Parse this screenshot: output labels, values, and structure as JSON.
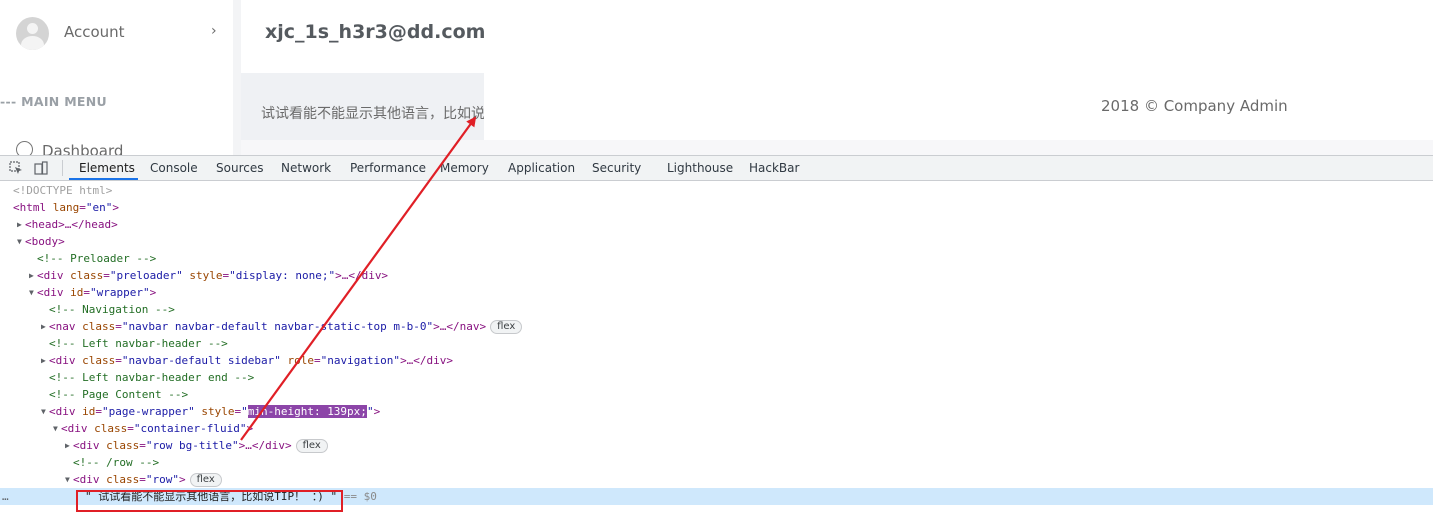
{
  "page": {
    "account_label": "Account",
    "account_chevron": "›",
    "main_menu_heading": "--- MAIN MENU",
    "dashboard_label": "Dashboard",
    "user_email": "xjc_1s_h3r3@dd.com",
    "content_text": "试试看能不能显示其他语言，比如说TIP！ ：)",
    "footer_text": "2018 © Company Admin"
  },
  "devtools": {
    "tabs": [
      "Elements",
      "Console",
      "Sources",
      "Network",
      "Performance",
      "Memory",
      "Application",
      "Security",
      "Lighthouse",
      "HackBar"
    ],
    "active_tab": "Elements",
    "dom": {
      "doctype": "<!DOCTYPE html>",
      "html_open_tag": "<html",
      "html_lang_attr": "lang",
      "html_lang_val": "\"en\"",
      "html_close": ">",
      "head_line": "<head>…</head>",
      "body_open": "<body>",
      "c_preloader": "<!-- Preloader -->",
      "div_open": "<div",
      "class_attr": "class",
      "id_attr": "id",
      "style_attr": "style",
      "role_attr": "role",
      "preloader_val": "\"preloader\"",
      "preloader_style_val": "\"display: none;\"",
      "collapsed_div_close": ">…</div>",
      "wrapper_val": "\"wrapper\"",
      "tag_close": ">",
      "c_navigation": "<!-- Navigation -->",
      "nav_open": "<nav",
      "nav_class_val": "\"navbar navbar-default navbar-static-top m-b-0\"",
      "nav_close": ">…</nav>",
      "c_left_header": "<!-- Left navbar-header -->",
      "sidebar_class_val": "\"navbar-default sidebar\"",
      "sidebar_role_val": "\"navigation\"",
      "c_left_header_end": "<!-- Left navbar-header end -->",
      "c_page_content": "<!-- Page Content -->",
      "page_wrapper_val": "\"page-wrapper\"",
      "page_wrapper_style_q": "\"",
      "page_wrapper_style_hl": "min-height: 139px;",
      "container_fluid_val": "\"container-fluid\"",
      "row_bg_title_val": "\"row bg-title\"",
      "c_row_end": "<!-- /row -->",
      "row_val": "\"row\"",
      "text_node": "\" 试试看能不能显示其他语言，比如说TIP！ ：) \"",
      "eq_dollar0": " == $0",
      "badge_flex": "flex",
      "sel_dots": "…",
      "eq": "="
    }
  },
  "annotation": {
    "box_color": "#e01f26",
    "arrow_color": "#e01f26"
  }
}
